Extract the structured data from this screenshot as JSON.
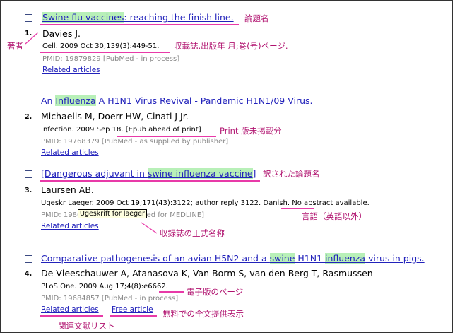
{
  "records": [
    {
      "index": "1.",
      "title_parts": [
        {
          "text": "Swine flu vaccines",
          "hl": true
        },
        {
          "text": ": reaching the finish line.",
          "hl": false
        }
      ],
      "authors": "Davies J.",
      "citation": "Cell. 2009 Oct 30;139(3):449-51.",
      "pmid": "PMID: 19879829 [PubMed - in process]",
      "links": [
        "Related articles"
      ]
    },
    {
      "index": "2.",
      "title_parts": [
        {
          "text": "An ",
          "hl": false
        },
        {
          "text": "Influenza",
          "hl": true
        },
        {
          "text": " A H1N1 Virus Revival - Pandemic H1N1/09 Virus.",
          "hl": false
        }
      ],
      "authors": "Michaelis M, Doerr HW, Cinatl J Jr.",
      "citation": "Infection. 2009 Sep 18. [Epub ahead of print]",
      "pmid": "PMID: 19768379 [PubMed - as supplied by publisher]",
      "links": [
        "Related articles"
      ]
    },
    {
      "index": "3.",
      "title_parts": [
        {
          "text": "[Dangerous adjuvant in ",
          "hl": false
        },
        {
          "text": "swine influenza vaccine",
          "hl": true
        },
        {
          "text": "]",
          "hl": false
        }
      ],
      "authors": "Laursen AB.",
      "citation": "Ugeskr Laeger. 2009 Oct 19;171(43):3122; author reply 3122. Danish. No abstract available.",
      "pmid_visible": "PMID: 1986",
      "pmid_tail": "exed for MEDLINE]",
      "links": [
        "Related articles"
      ]
    },
    {
      "index": "4.",
      "title_parts": [
        {
          "text": "Comparative pathogenesis of an avian H5N2 and a ",
          "hl": false
        },
        {
          "text": "swine",
          "hl": true
        },
        {
          "text": " H1N1 ",
          "hl": false
        },
        {
          "text": "influenza",
          "hl": true
        },
        {
          "text": " virus in pigs.",
          "hl": false
        }
      ],
      "authors": "De Vleeschauwer A, Atanasova K, Van Borm S, van den Berg T, Rasmussen",
      "citation": "PLoS One. 2009 Aug 17;4(8):e6662.",
      "pmid": "PMID: 19684857 [PubMed - in process]",
      "links": [
        "Related articles",
        "Free article"
      ]
    }
  ],
  "tooltip": "Ugeskrift for laeger",
  "annotations": {
    "title": "論題名",
    "author": "著者",
    "journal": "収載誌.出版年 月;巻(号)ページ.",
    "print": "Print 版未掲載分",
    "translated_title": "訳された論題名",
    "language": "言語（英語以外）",
    "official_name": "収録誌の正式名称",
    "electronic": "電子版のページ",
    "free_text": "無料での全文提供表示",
    "related": "関連文献リスト"
  },
  "colors": {
    "annotation": "#b0126f",
    "underline": "#e83aa8",
    "highlight": "#b8f0b8",
    "link": "#2222bb"
  }
}
